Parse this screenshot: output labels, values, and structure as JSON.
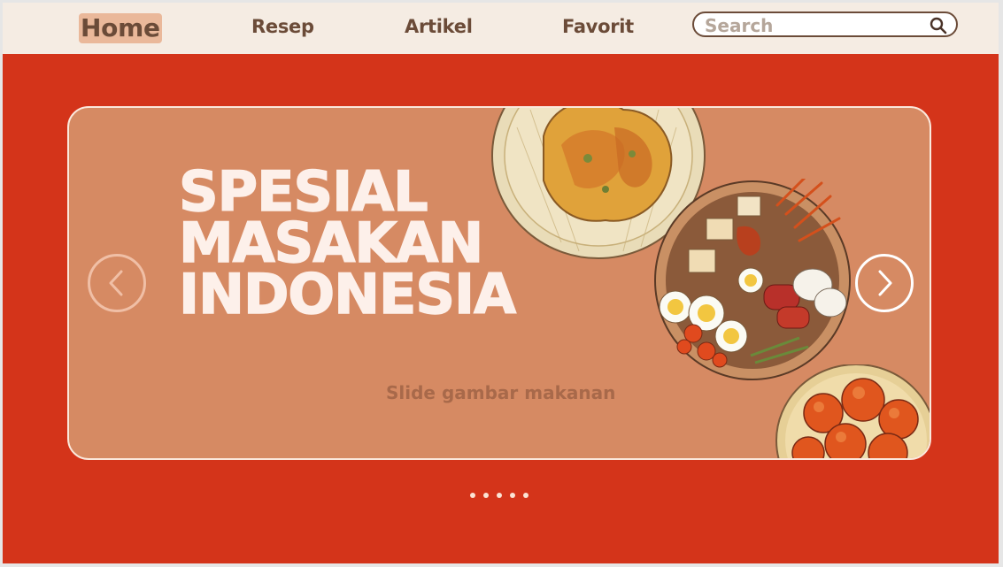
{
  "nav": {
    "items": [
      {
        "label": "Home",
        "active": true
      },
      {
        "label": "Resep"
      },
      {
        "label": "Artikel"
      },
      {
        "label": "Favorit"
      }
    ],
    "search": {
      "placeholder": "Search",
      "value": ""
    }
  },
  "hero": {
    "headline": [
      "SPESIAL",
      "MASAKAN",
      "INDONESIA"
    ],
    "caption": "Slide gambar makanan",
    "slide_count": 5,
    "active_slide": 0,
    "icons": {
      "prev": "chevron-left-icon",
      "next": "chevron-right-icon"
    }
  },
  "colors": {
    "background": "#d4341a",
    "nav_bg": "#f5ece3",
    "banner_bg": "#d68a63",
    "text_brown": "#6b4b38",
    "home_highlight": "#eab89a"
  }
}
